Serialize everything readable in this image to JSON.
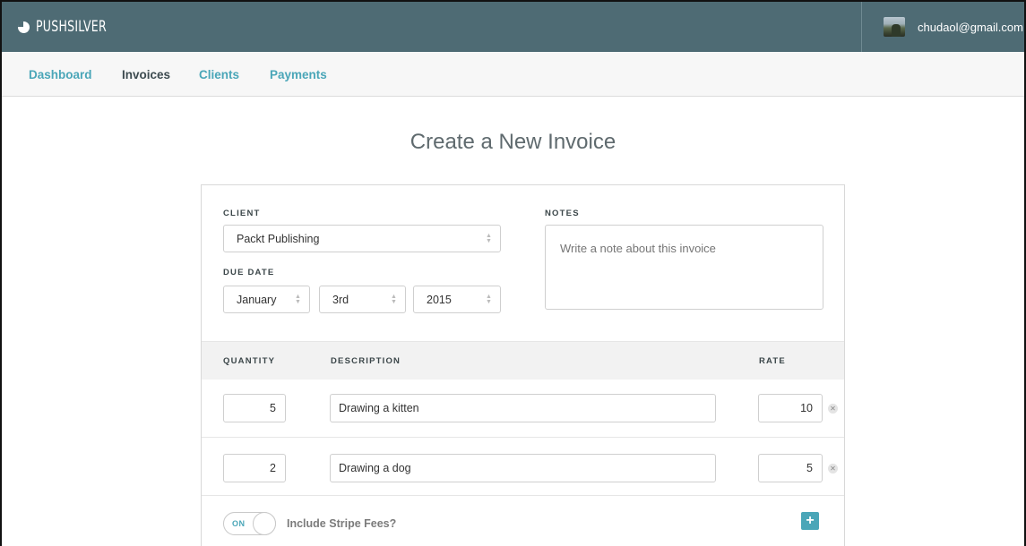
{
  "header": {
    "brand": "PUSHSILVER",
    "user_email": "chudaol@gmail.com"
  },
  "nav": {
    "items": [
      {
        "label": "Dashboard",
        "active": false
      },
      {
        "label": "Invoices",
        "active": true
      },
      {
        "label": "Clients",
        "active": false
      },
      {
        "label": "Payments",
        "active": false
      }
    ]
  },
  "page": {
    "title": "Create a New Invoice"
  },
  "form": {
    "client_label": "CLIENT",
    "client_value": "Packt Publishing",
    "due_date_label": "DUE DATE",
    "due_month": "January",
    "due_day": "3rd",
    "due_year": "2015",
    "notes_label": "NOTES",
    "notes_placeholder": "Write a note about this invoice"
  },
  "table": {
    "headers": {
      "quantity": "QUANTITY",
      "description": "DESCRIPTION",
      "rate": "RATE"
    },
    "rows": [
      {
        "quantity": "5",
        "description": "Drawing a kitten",
        "rate": "10"
      },
      {
        "quantity": "2",
        "description": "Drawing a dog",
        "rate": "5"
      }
    ]
  },
  "footer": {
    "toggle_state": "ON",
    "stripe_label": "Include Stripe Fees?",
    "add_icon": "+"
  },
  "colors": {
    "topbar": "#4e6b74",
    "accent": "#4aa6b8"
  }
}
